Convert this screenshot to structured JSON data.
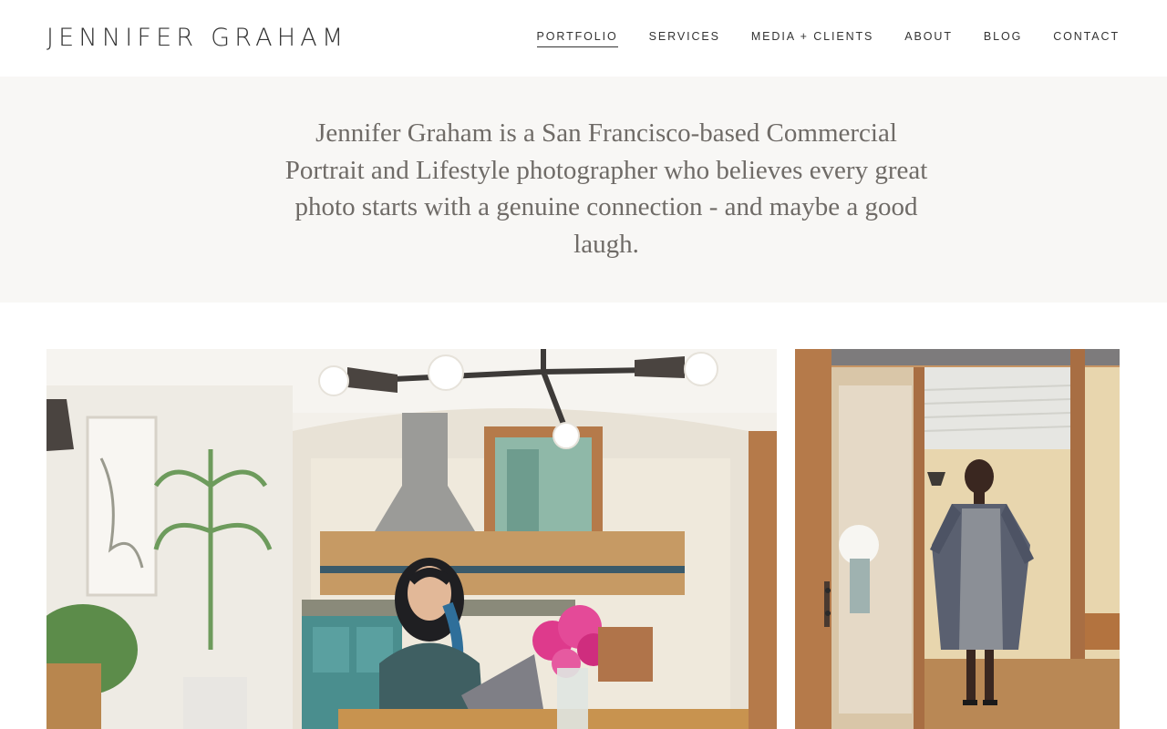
{
  "site": {
    "title": "JENNIFER GRAHAM"
  },
  "nav": {
    "items": [
      {
        "label": "PORTFOLIO",
        "active": true
      },
      {
        "label": "SERVICES",
        "active": false
      },
      {
        "label": "MEDIA + CLIENTS",
        "active": false
      },
      {
        "label": "ABOUT",
        "active": false
      },
      {
        "label": "BLOG",
        "active": false
      },
      {
        "label": "CONTACT",
        "active": false
      }
    ]
  },
  "intro": {
    "text": "Jennifer Graham is a San Francisco-based Commercial Portrait and Lifestyle photographer who believes every great photo starts with a genuine connection - and maybe a good laugh."
  },
  "colors": {
    "text": "#333333",
    "intro_bg": "#f8f7f5",
    "intro_text": "#6f6b67"
  }
}
